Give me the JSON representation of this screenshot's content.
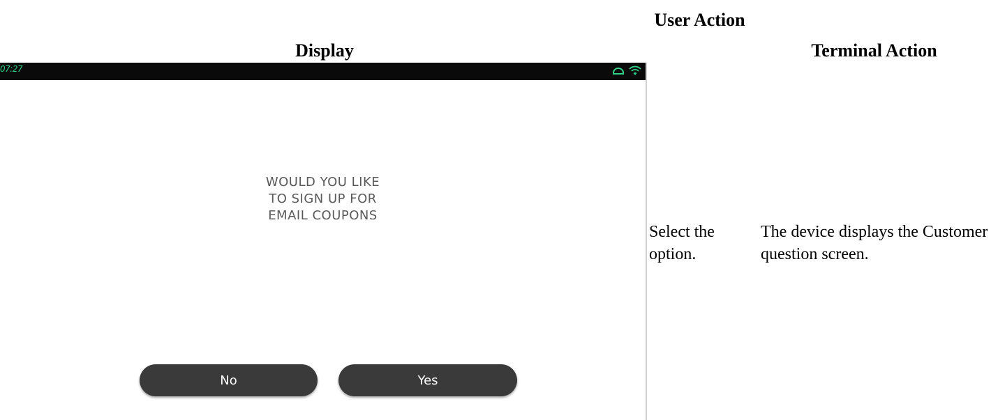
{
  "headers": {
    "display": "Display",
    "user_action": "User Action",
    "terminal_action": "Terminal Action"
  },
  "device": {
    "status_bar": {
      "time": "07:27",
      "icons": [
        "cloud-icon",
        "wifi-icon"
      ],
      "accent_color": "#2fd08a"
    },
    "question_lines": [
      "WOULD YOU LIKE",
      "TO SIGN UP FOR",
      "EMAIL COUPONS"
    ],
    "buttons": {
      "no_label": "No",
      "yes_label": "Yes"
    }
  },
  "row": {
    "user_action": "Select the option.",
    "terminal_action": "The device displays the Customer question screen."
  }
}
